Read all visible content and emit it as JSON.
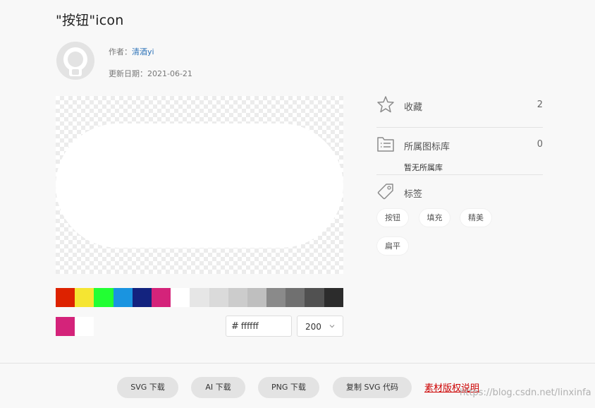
{
  "header": {
    "title": "\"按钮\"icon"
  },
  "author": {
    "label": "作者：",
    "name": "清酒yi"
  },
  "date": {
    "label": "更新日期：",
    "value": "2021-06-21"
  },
  "palette": {
    "swatches": [
      "#dd2200",
      "#f5e532",
      "#22ff33",
      "#1a94e0",
      "#13237f",
      "#d4237a",
      "#ffffff",
      "#e6e6e6",
      "#dadada",
      "#cccccc",
      "#bfbfbf",
      "#8a8a8a",
      "#707070",
      "#515151",
      "#2c2c2c"
    ],
    "current": [
      "#d4237a",
      "#ffffff"
    ]
  },
  "color_input": {
    "hash": "#",
    "value": "ffffff"
  },
  "size_select": {
    "value": "200"
  },
  "sidebar": {
    "favorite": {
      "label": "收藏",
      "count": "2",
      "icon": "star-icon"
    },
    "library": {
      "label": "所属图标库",
      "count": "0",
      "empty_text": "暂无所属库",
      "icon": "folder-list-icon"
    },
    "tags": {
      "label": "标签",
      "icon": "tag-icon",
      "items": [
        "按钮",
        "填充",
        "精美",
        "扁平"
      ]
    }
  },
  "footer": {
    "buttons": [
      "SVG 下载",
      "AI 下载",
      "PNG 下载",
      "复制 SVG 代码"
    ],
    "copyright_link": "素材版权说明",
    "watermark": "https://blog.csdn.net/linxinfa"
  }
}
